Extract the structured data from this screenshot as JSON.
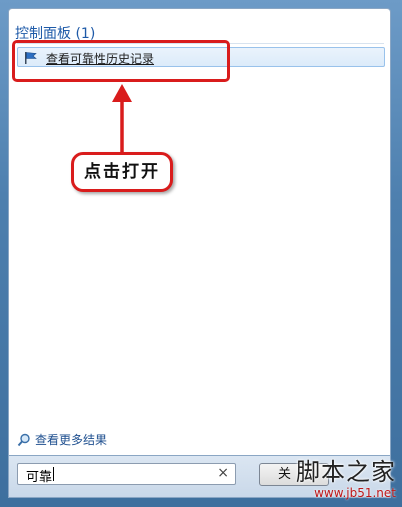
{
  "start_menu": {
    "section_header": "控制面板 (1)",
    "results": [
      {
        "label": "查看可靠性历史记录",
        "icon": "flag-icon"
      }
    ],
    "more_results_label": "查看更多结果",
    "more_results_icon": "magnifier-icon"
  },
  "annotation": {
    "callout_text": "点击打开",
    "accent_color": "#d91c1c"
  },
  "search": {
    "value": "可靠",
    "clear_glyph": "×"
  },
  "shutdown_button": {
    "label": "关"
  },
  "watermark": {
    "site_name": "脚本之家",
    "url": "www.jb51.net"
  }
}
